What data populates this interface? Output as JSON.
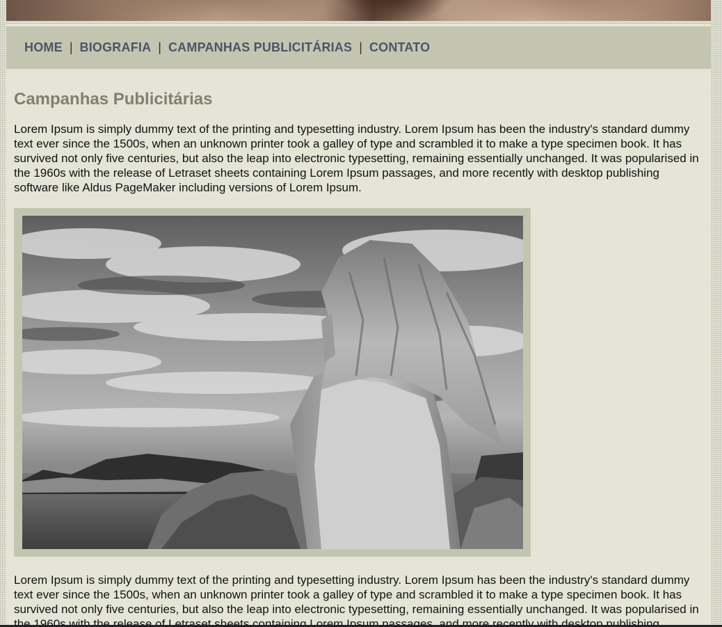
{
  "nav": {
    "items": [
      {
        "label": "HOME"
      },
      {
        "label": "BIOGRAFIA"
      },
      {
        "label": "CAMPANHAS PUBLICITÁRIAS"
      },
      {
        "label": "CONTATO"
      }
    ],
    "separator": "|"
  },
  "main": {
    "title": "Campanhas Publicitárias",
    "paragraph_1": "Lorem Ipsum is simply dummy text of the printing and typesetting industry. Lorem Ipsum has been the industry's standard dummy text ever since the 1500s, when an unknown printer took a galley of type and scrambled it to make a type specimen book. It has survived not only five centuries, but also the leap into electronic typesetting, remaining essentially unchanged. It was popularised in the 1960s with the release of Letraset sheets containing Lorem Ipsum passages, and more recently with desktop publishing software like Aldus PageMaker including versions of Lorem Ipsum.",
    "paragraph_2": "Lorem Ipsum is simply dummy text of the printing and typesetting industry. Lorem Ipsum has been the industry's standard dummy text ever since the 1500s, when an unknown printer took a galley of type and scrambled it to make a type specimen book. It has survived not only five centuries, but also the leap into electronic typesetting, remaining essentially unchanged. It was popularised in the 1960s with the release of Letraset sheets containing Lorem Ipsum passages, and more recently with desktop publishing software like Aldus PageMaker including versions of Lorem Ipsum."
  },
  "colors": {
    "page_background": "#e4e5d6",
    "nav_background": "#c4c5b0",
    "nav_link": "#4a5568",
    "title": "#808070",
    "photo_frame": "#c4c5b0"
  }
}
